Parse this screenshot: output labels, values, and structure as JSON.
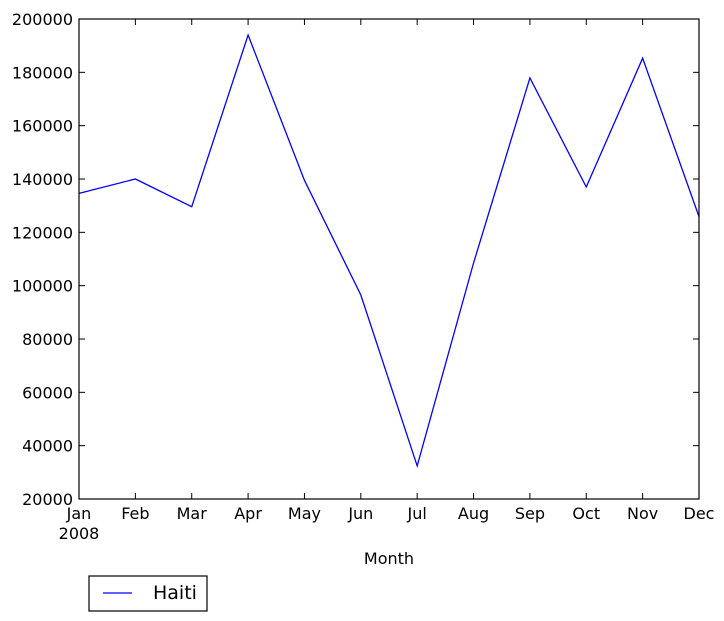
{
  "chart_data": {
    "type": "line",
    "title": "",
    "xlabel": "Month",
    "ylabel": "",
    "categories": [
      "Jan",
      "Feb",
      "Mar",
      "Apr",
      "May",
      "Jun",
      "Jul",
      "Aug",
      "Sep",
      "Oct",
      "Nov",
      "Dec"
    ],
    "x_tick_labels": [
      "Jan",
      "Feb",
      "Mar",
      "Apr",
      "May",
      "Jun",
      "Jul",
      "Aug",
      "Sep",
      "Oct",
      "Nov",
      "Dec"
    ],
    "x_tick_sublabel": "2008",
    "y_ticks": [
      20000,
      40000,
      60000,
      80000,
      100000,
      120000,
      140000,
      160000,
      180000,
      200000
    ],
    "y_tick_labels": [
      "20000",
      "40000",
      "60000",
      "80000",
      "100000",
      "120000",
      "140000",
      "160000",
      "180000",
      "200000"
    ],
    "ylim": [
      20000,
      200000
    ],
    "grid": false,
    "series": [
      {
        "name": "Haiti",
        "color": "#0000ff",
        "values": [
          134600,
          140000,
          129600,
          194000,
          139500,
          96500,
          32400,
          108500,
          177900,
          137000,
          185300,
          125900
        ]
      }
    ],
    "legend": {
      "placement": "below-left",
      "entries": [
        "Haiti"
      ]
    }
  }
}
